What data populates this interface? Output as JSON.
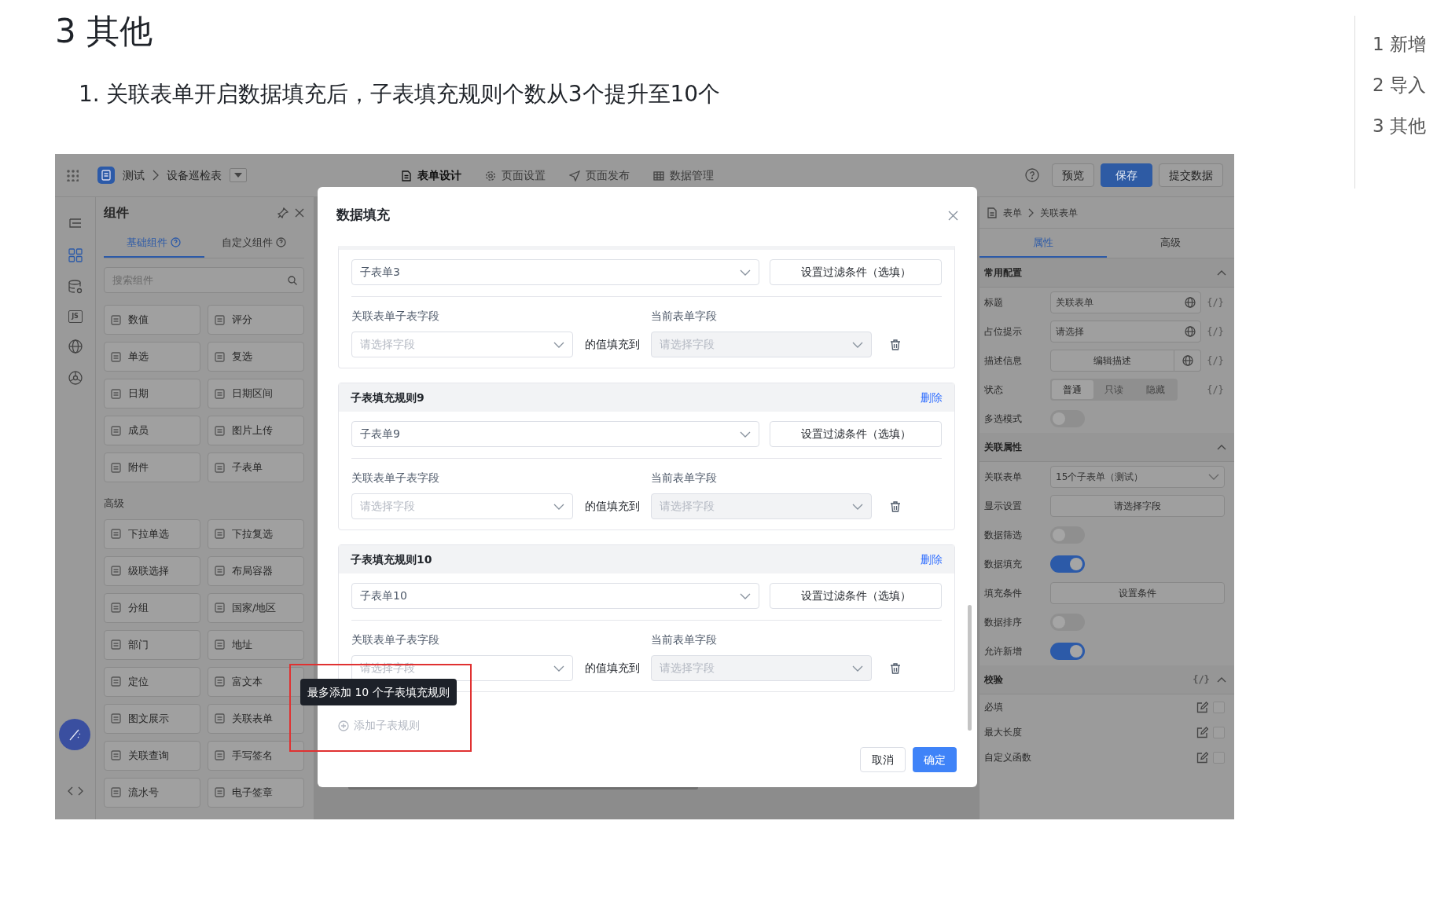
{
  "doc": {
    "heading": "3 其他",
    "items": [
      {
        "number": "1.",
        "text": "关联表单开启数据填充后，子表填充规则个数从3个提升至10个"
      }
    ]
  },
  "toc": [
    {
      "label": "1 新增"
    },
    {
      "label": "2 导入"
    },
    {
      "label": "3 其他"
    }
  ],
  "app": {
    "topbar": {
      "breadcrumb": [
        "测试",
        "设备巡检表"
      ],
      "tabs": [
        {
          "label": "表单设计",
          "kind": "document",
          "selected": true
        },
        {
          "label": "页面设置",
          "kind": "gear",
          "selected": false
        },
        {
          "label": "页面发布",
          "kind": "send",
          "selected": false
        },
        {
          "label": "数据管理",
          "kind": "table",
          "selected": false
        }
      ],
      "buttons": [
        {
          "label": "预览",
          "kind": "default"
        },
        {
          "label": "保存",
          "kind": "primary"
        },
        {
          "label": "提交数据",
          "kind": "default"
        }
      ]
    },
    "rail": [
      {
        "kind": "outline",
        "selected": false
      },
      {
        "kind": "components",
        "selected": true
      },
      {
        "kind": "data",
        "selected": false
      },
      {
        "kind": "script",
        "label": "JS",
        "selected": false
      },
      {
        "kind": "globe",
        "selected": false
      },
      {
        "kind": "theme",
        "selected": false
      }
    ],
    "components_panel": {
      "title": "组件",
      "tabs": [
        {
          "label": "基础组件",
          "selected": true
        },
        {
          "label": "自定义组件",
          "selected": false
        }
      ],
      "search": {
        "placeholder": "搜索组件"
      },
      "groups": [
        {
          "items": [
            "数值",
            "评分",
            "单选",
            "复选",
            "日期",
            "日期区间",
            "成员",
            "图片上传",
            "附件",
            "子表单"
          ]
        },
        {
          "title": "高级",
          "items": [
            "下拉单选",
            "下拉复选",
            "级联选择",
            "布局容器",
            "分组",
            "国家/地区",
            "部门",
            "地址",
            "定位",
            "富文本",
            "图文展示",
            "关联表单",
            "关联查询",
            "手写签名",
            "流水号",
            "电子签章"
          ]
        }
      ]
    },
    "modal": {
      "title": "数据填充",
      "rules": [
        {
          "subform": "子表单3",
          "filter_button": "设置过滤条件（选填）",
          "mapping": {
            "source_label": "关联表单子表字段",
            "source_placeholder": "请选择字段",
            "connector": "的值填充到",
            "target_label": "当前表单字段",
            "target_placeholder": "请选择字段",
            "target_disabled": true
          }
        },
        {
          "title": "子表填充规则9",
          "delete_label": "删除",
          "subform": "子表单9",
          "filter_button": "设置过滤条件（选填）",
          "mapping": {
            "source_label": "关联表单子表字段",
            "source_placeholder": "请选择字段",
            "connector": "的值填充到",
            "target_label": "当前表单字段",
            "target_placeholder": "请选择字段",
            "target_disabled": true
          }
        },
        {
          "title": "子表填充规则10",
          "delete_label": "删除",
          "subform": "子表单10",
          "filter_button": "设置过滤条件（选填）",
          "mapping": {
            "source_label": "关联表单子表字段",
            "source_placeholder": "请选择字段",
            "connector": "的值填充到",
            "target_label": "当前表单字段",
            "target_placeholder": "请选择字段",
            "target_disabled": true
          }
        }
      ],
      "add_rule": {
        "label": "添加子表规则",
        "disabled": true
      },
      "tooltip": "最多添加 10 个子表填充规则",
      "cancel": "取消",
      "confirm": "确定"
    },
    "properties_panel": {
      "breadcrumb": [
        "表单",
        "关联表单"
      ],
      "tabs": [
        {
          "label": "属性",
          "selected": true
        },
        {
          "label": "高级",
          "selected": false
        }
      ],
      "sections": [
        {
          "title": "常用配置",
          "expanded": true,
          "rows": [
            {
              "label": "标题",
              "kind": "input",
              "value": "关联表单",
              "globe": true,
              "expr": "{/}"
            },
            {
              "label": "占位提示",
              "kind": "input",
              "value": "请选择",
              "globe": true,
              "expr": "{/}"
            },
            {
              "label": "描述信息",
              "kind": "button",
              "value": "编辑描述",
              "globe": true,
              "expr": "{/}"
            },
            {
              "label": "状态",
              "kind": "segmented",
              "options": [
                {
                  "label": "普通",
                  "selected": true
                },
                {
                  "label": "只读",
                  "selected": false
                },
                {
                  "label": "隐藏",
                  "selected": false
                }
              ],
              "expr": "{/}"
            },
            {
              "label": "多选模式",
              "kind": "switch",
              "on": false
            }
          ]
        },
        {
          "title": "关联属性",
          "expanded": true,
          "rows": [
            {
              "label": "关联表单",
              "kind": "select",
              "value": "15个子表单（测试）"
            },
            {
              "label": "显示设置",
              "kind": "button",
              "value": "请选择字段"
            },
            {
              "label": "数据筛选",
              "kind": "switch",
              "on": false
            },
            {
              "label": "数据填充",
              "kind": "switch",
              "on": true
            },
            {
              "label": "填充条件",
              "kind": "button",
              "value": "设置条件"
            },
            {
              "label": "数据排序",
              "kind": "switch",
              "on": false
            },
            {
              "label": "允许新增",
              "kind": "switch",
              "on": true
            }
          ]
        },
        {
          "title": "校验",
          "expanded": true,
          "expr": "{/}",
          "rows": [
            {
              "label": "必填",
              "kind": "check",
              "checked": false
            },
            {
              "label": "最大长度",
              "kind": "check",
              "checked": false
            },
            {
              "label": "自定义函数",
              "kind": "check",
              "checked": false
            }
          ]
        }
      ]
    }
  }
}
